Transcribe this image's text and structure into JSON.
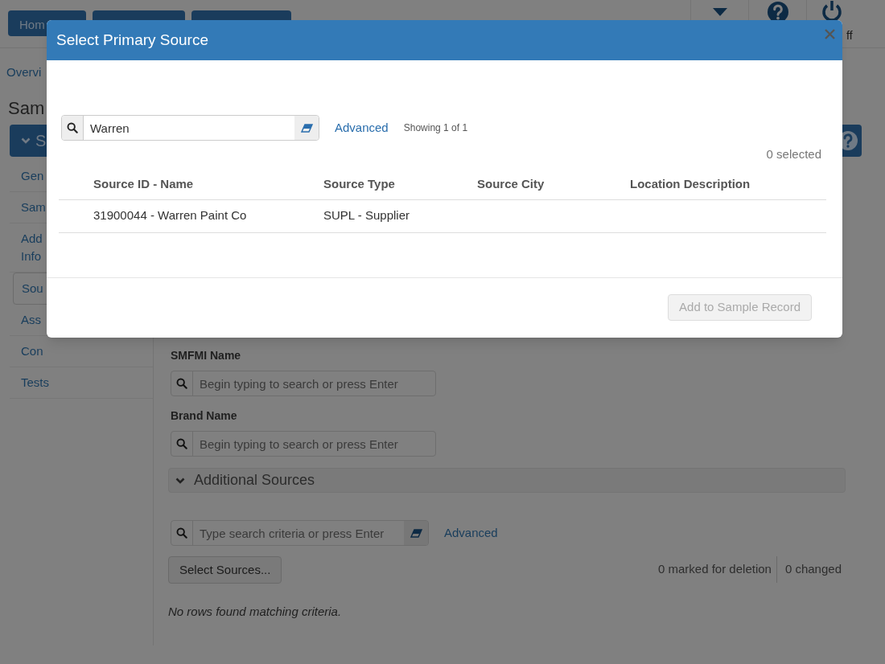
{
  "top_bar": {
    "logoff_label": "ff",
    "home_label": "Hom"
  },
  "page": {
    "breadcrumb": "Overvi",
    "title": "Sam",
    "section_header": "S",
    "sidebar": [
      {
        "lines": [
          "Gen"
        ],
        "selected": false
      },
      {
        "lines": [
          "Sam"
        ],
        "selected": false
      },
      {
        "lines": [
          "Add",
          "Info"
        ],
        "selected": false
      },
      {
        "lines": [
          "Sou"
        ],
        "selected": true
      },
      {
        "lines": [
          "Ass"
        ],
        "selected": false
      },
      {
        "lines": [
          "Con"
        ],
        "selected": false
      },
      {
        "lines": [
          "Tests"
        ],
        "selected": false
      }
    ],
    "fields": [
      {
        "label": "SMFMI Name",
        "placeholder": "Begin typing to search or press Enter"
      },
      {
        "label": "Brand Name",
        "placeholder": "Begin typing to search or press Enter"
      }
    ],
    "additional_sources": {
      "title": "Additional Sources",
      "expanded": true,
      "search_placeholder": "Type search criteria or press Enter",
      "advanced_link": "Advanced",
      "select_button": "Select Sources...",
      "marked_for_deletion": "0 marked for deletion",
      "changed": "0 changed",
      "empty_message": "No rows found matching criteria."
    }
  },
  "modal": {
    "title": "Select Primary Source",
    "search_value": "Warren",
    "advanced_link": "Advanced",
    "showing": "Showing 1 of 1",
    "selected_count": "0 selected",
    "columns": [
      "Source ID - Name",
      "Source Type",
      "Source City",
      "Location Description"
    ],
    "rows": [
      {
        "cells": [
          "31900044 - Warren Paint Co",
          "SUPL - Supplier"
        ]
      }
    ],
    "add_button": {
      "label": "Add to Sample Record",
      "disabled": true
    }
  }
}
